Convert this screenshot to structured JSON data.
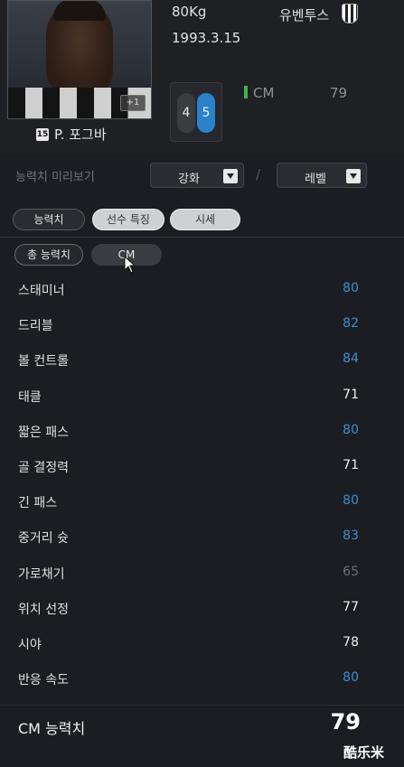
{
  "player": {
    "weight": "80Kg",
    "birth": "1993.3.15",
    "club": "유벤투스",
    "number": "15",
    "name": "P. 포그바",
    "plus": "+1",
    "foot_left": "4",
    "foot_right": "5",
    "position": "CM",
    "position_ovr": "79"
  },
  "preview": {
    "label": "능력치 미리보기",
    "enhance_label": "강화",
    "level_label": "레벨",
    "separator": "/"
  },
  "tabs": {
    "stats": "능력치",
    "traits": "선수 특징",
    "market": "시세"
  },
  "subtabs": {
    "total": "총 능력치",
    "position": "CM"
  },
  "stats": [
    {
      "name": "스태미너",
      "value": "80",
      "color": "#3a8fd6"
    },
    {
      "name": "드리블",
      "value": "82",
      "color": "#3a8fd6"
    },
    {
      "name": "볼 컨트롤",
      "value": "84",
      "color": "#3a8fd6"
    },
    {
      "name": "태클",
      "value": "71",
      "color": "#f0f0f0"
    },
    {
      "name": "짧은 패스",
      "value": "80",
      "color": "#3a8fd6"
    },
    {
      "name": "골 결정력",
      "value": "71",
      "color": "#f0f0f0"
    },
    {
      "name": "긴 패스",
      "value": "80",
      "color": "#3a8fd6"
    },
    {
      "name": "중거리 슛",
      "value": "83",
      "color": "#3a8fd6"
    },
    {
      "name": "가로채기",
      "value": "65",
      "color": "#6c6f74"
    },
    {
      "name": "위치 선정",
      "value": "77",
      "color": "#f0f0f0"
    },
    {
      "name": "시야",
      "value": "78",
      "color": "#f0f0f0"
    },
    {
      "name": "반응 속도",
      "value": "80",
      "color": "#3a8fd6"
    }
  ],
  "total": {
    "label": "CM 능력치",
    "value": "79"
  },
  "watermark": "酷乐米"
}
